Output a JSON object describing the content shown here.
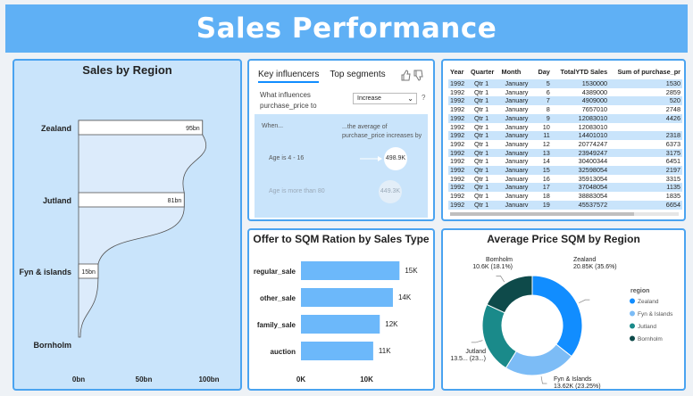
{
  "title": "Sales Performance",
  "region_panel": {
    "title": "Sales by Region"
  },
  "key_influencers": {
    "tabs": [
      "Key influencers",
      "Top segments"
    ],
    "question_line1": "What influences",
    "question_line2": "purchase_price to",
    "dropdown_value": "Increase",
    "help": "?",
    "col_when": "When...",
    "col_avg_line1": "...the average of",
    "col_avg_line2": "purchase_price increases by",
    "rows": [
      {
        "label": "Age is 4 - 16",
        "value": "498.9K"
      },
      {
        "label": "Age is more than 80",
        "value": "449.3K"
      }
    ],
    "icons": [
      "thumbs-up-icon",
      "thumbs-down-icon"
    ]
  },
  "table": {
    "headers": [
      "Year",
      "Quarter",
      "Month",
      "Day",
      "TotalYTD Sales",
      "Sum of purchase_pr"
    ],
    "rows": [
      [
        "1992",
        "Qtr 1",
        "January",
        "5",
        "1530000",
        "1530"
      ],
      [
        "1992",
        "Qtr 1",
        "January",
        "6",
        "4389000",
        "2859"
      ],
      [
        "1992",
        "Qtr 1",
        "January",
        "7",
        "4909000",
        "520"
      ],
      [
        "1992",
        "Qtr 1",
        "January",
        "8",
        "7657010",
        "2748"
      ],
      [
        "1992",
        "Qtr 1",
        "January",
        "9",
        "12083010",
        "4426"
      ],
      [
        "1992",
        "Qtr 1",
        "January",
        "10",
        "12083010",
        ""
      ],
      [
        "1992",
        "Qtr 1",
        "January",
        "11",
        "14401010",
        "2318"
      ],
      [
        "1992",
        "Qtr 1",
        "January",
        "12",
        "20774247",
        "6373"
      ],
      [
        "1992",
        "Qtr 1",
        "January",
        "13",
        "23949247",
        "3175"
      ],
      [
        "1992",
        "Qtr 1",
        "January",
        "14",
        "30400344",
        "6451"
      ],
      [
        "1992",
        "Qtr 1",
        "January",
        "15",
        "32598054",
        "2197"
      ],
      [
        "1992",
        "Qtr 1",
        "January",
        "16",
        "35913054",
        "3315"
      ],
      [
        "1992",
        "Qtr 1",
        "January",
        "17",
        "37048054",
        "1135"
      ],
      [
        "1992",
        "Qtr 1",
        "January",
        "18",
        "38883054",
        "1835"
      ],
      [
        "1992",
        "Qtr 1",
        "Januarv",
        "19",
        "45537572",
        "6654"
      ]
    ]
  },
  "chart_data": [
    {
      "type": "bar",
      "title": "Sales by Region",
      "orientation": "horizontal",
      "categories": [
        "Zealand",
        "Jutland",
        "Fyn & islands",
        "Bornholm"
      ],
      "values": [
        95,
        81,
        15,
        0
      ],
      "data_labels": [
        "95bn",
        "81bn",
        "15bn",
        ""
      ],
      "x_ticks": [
        "0bn",
        "50bn",
        "100bn"
      ],
      "xlim": [
        0,
        100
      ]
    },
    {
      "type": "bar",
      "title": "Offer to SQM Ration by Sales Type",
      "orientation": "horizontal",
      "categories": [
        "regular_sale",
        "other_sale",
        "family_sale",
        "auction"
      ],
      "values": [
        15,
        14,
        12,
        11
      ],
      "data_labels": [
        "15K",
        "14K",
        "12K",
        "11K"
      ],
      "x_ticks": [
        "0K",
        "10K"
      ],
      "xlim": [
        0,
        15.5
      ],
      "color": "#6cb8fa"
    },
    {
      "type": "pie",
      "title": "Average Price SQM by Region",
      "donut": true,
      "legend_title": "region",
      "slices": [
        {
          "name": "Zealand",
          "value": 35.6,
          "label_line1": "Zealand",
          "label_line2": "20.85K (35.6%)",
          "color": "#118dff"
        },
        {
          "name": "Fyn & Islands",
          "value": 23.25,
          "label_line1": "Fyn & Islands",
          "label_line2": "13.62K (23.25%)",
          "color": "#7cbcf6"
        },
        {
          "name": "Jutland",
          "value": 23.05,
          "label_line1": "Jutland",
          "label_line2": "13.5... (23...)",
          "color": "#1a8a8a"
        },
        {
          "name": "Bornholm",
          "value": 18.1,
          "label_line1": "Bornholm",
          "label_line2": "10.6K (18.1%)",
          "color": "#0e4a4a"
        }
      ]
    }
  ]
}
